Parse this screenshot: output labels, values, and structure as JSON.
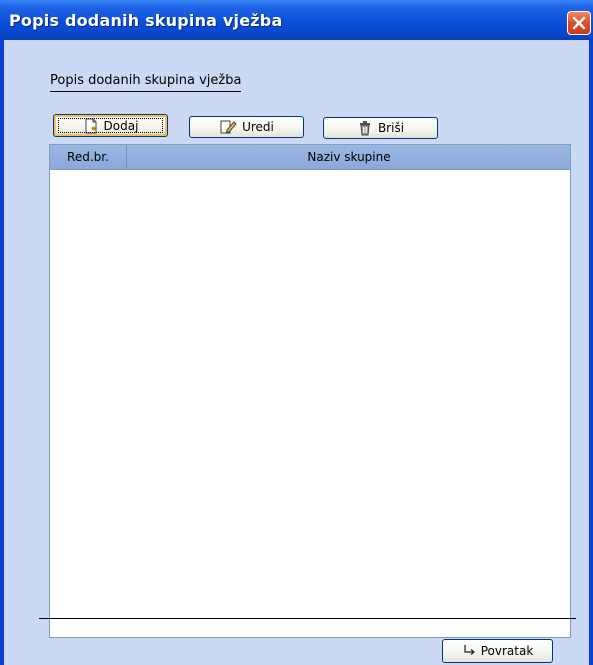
{
  "window": {
    "title": "Popis dodanih skupina vježba"
  },
  "section": {
    "label": "Popis dodanih skupina vježba"
  },
  "toolbar": {
    "add_label": "Dodaj",
    "edit_label": "Uredi",
    "delete_label": "Briši"
  },
  "table": {
    "columns": [
      "Red.br.",
      "Naziv skupine"
    ],
    "rows": []
  },
  "footer": {
    "back_label": "Povratak"
  },
  "colors": {
    "titlebar": "#0a50d8",
    "client": "#cbd9f5",
    "header": "#8aa9da",
    "close": "#e0532e"
  }
}
